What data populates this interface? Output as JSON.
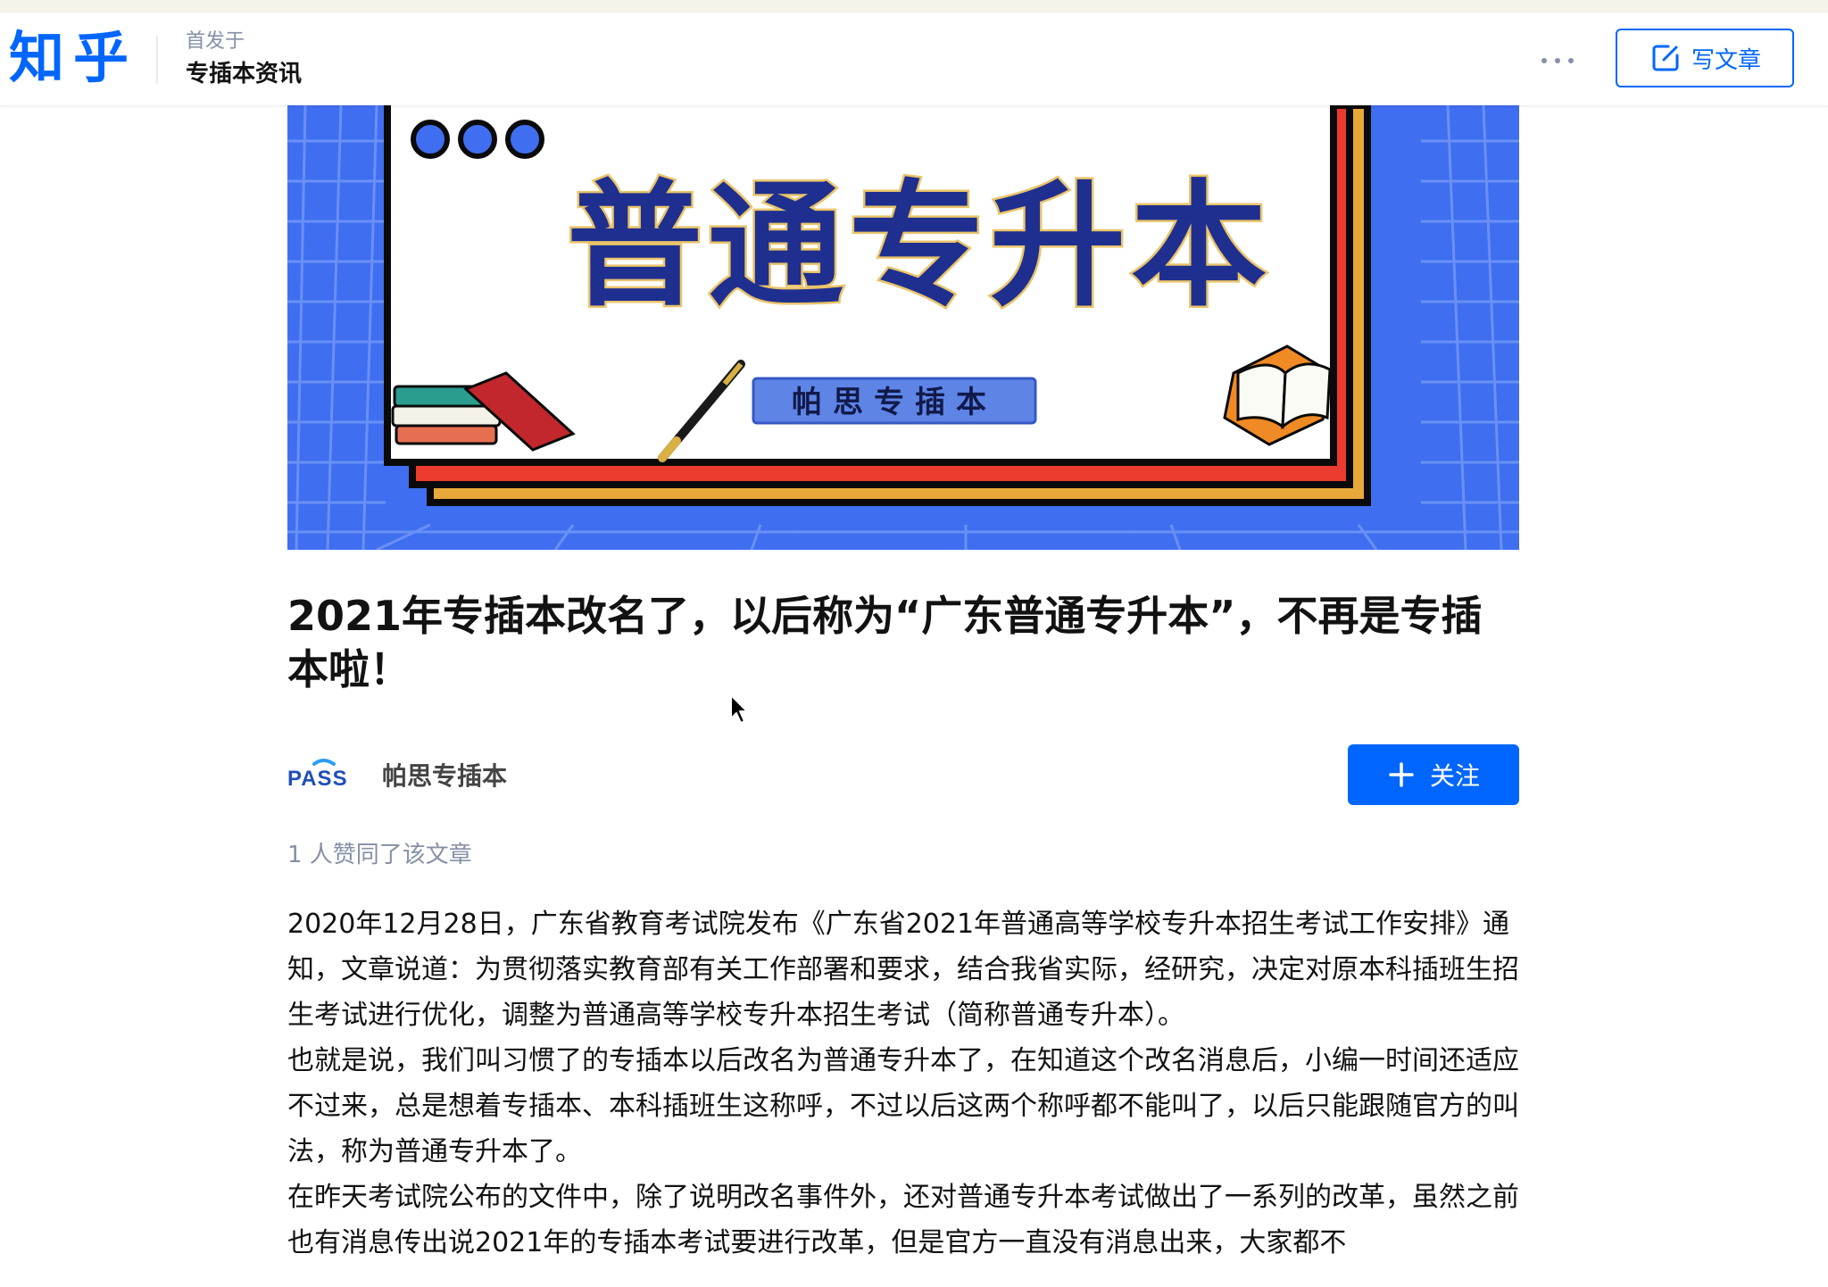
{
  "header": {
    "logo": "知乎",
    "published_label": "首发于",
    "column_name": "专插本资讯",
    "write_label": "写文章",
    "more_icon": "more-dots-icon",
    "write_icon": "edit-icon"
  },
  "banner": {
    "headline": "普通专升本",
    "subtitle": "帕思专插本"
  },
  "article": {
    "title": "2021年专插本改名了，以后称为“广东普通专升本”，不再是专插本啦！",
    "author_name": "帕思专插本",
    "avatar_text": "PASS",
    "follow_label": "关注",
    "likes_text": "1 人赞同了该文章",
    "paragraphs": [
      "2020年12月28日，广东省教育考试院发布《广东省2021年普通高等学校专升本招生考试工作安排》通知，文章说道：为贯彻落实教育部有关工作部署和要求，结合我省实际，经研究，决定对原本科插班生招生考试进行优化，调整为普通高等学校专升本招生考试（简称普通专升本）。",
      "也就是说，我们叫习惯了的专插本以后改名为普通专升本了，在知道这个改名消息后，小编一时间还适应不过来，总是想着专插本、本科插班生这称呼，不过以后这两个称呼都不能叫了，以后只能跟随官方的叫法，称为普通专升本了。",
      "在昨天考试院公布的文件中，除了说明改名事件外，还对普通专升本考试做出了一系列的改革，虽然之前也有消息传出说2021年的专插本考试要进行改革，但是官方一直没有消息出来，大家都不"
    ]
  },
  "colors": {
    "brand": "#0066ff",
    "banner_blue": "#3f6ff0",
    "headline_navy": "#1f2f8f"
  }
}
